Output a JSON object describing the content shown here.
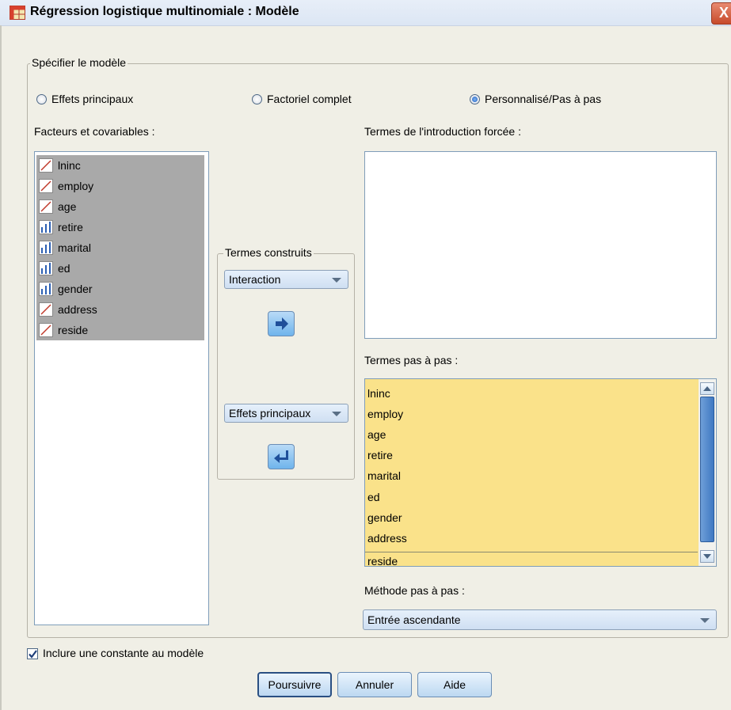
{
  "window": {
    "title": "Régression logistique multinomiale : Modèle",
    "close_glyph": "X"
  },
  "specify_group": {
    "legend": "Spécifier le modèle"
  },
  "model_options": [
    {
      "label": "Effets principaux",
      "selected": false
    },
    {
      "label": "Factoriel complet",
      "selected": false
    },
    {
      "label": "Personnalisé/Pas à pas",
      "selected": true
    }
  ],
  "factors": {
    "label": "Facteurs et covariables :",
    "items": [
      {
        "name": "lninc",
        "icon": "scale-icon"
      },
      {
        "name": "employ",
        "icon": "scale-icon"
      },
      {
        "name": "age",
        "icon": "scale-icon"
      },
      {
        "name": "retire",
        "icon": "nominal-bar-icon"
      },
      {
        "name": "marital",
        "icon": "nominal-bar-icon"
      },
      {
        "name": "ed",
        "icon": "nominal-bar-icon"
      },
      {
        "name": "gender",
        "icon": "nominal-bar-icon"
      },
      {
        "name": "address",
        "icon": "scale-icon"
      },
      {
        "name": "reside",
        "icon": "scale-icon"
      }
    ]
  },
  "built_terms": {
    "legend": "Termes construits",
    "combo_top": "Interaction",
    "combo_bottom": "Effets principaux"
  },
  "forced_terms": {
    "label": "Termes de l'introduction forcée :"
  },
  "stepwise_terms": {
    "label": "Termes pas à pas :",
    "items": [
      "lninc",
      "employ",
      "age",
      "retire",
      "marital",
      "ed",
      "gender",
      "address",
      "reside"
    ]
  },
  "stepwise_method": {
    "label": "Méthode pas à pas :",
    "value": "Entrée ascendante"
  },
  "include_constant": {
    "label": "Inclure une constante au modèle",
    "checked": true
  },
  "buttons": {
    "continue": "Poursuivre",
    "cancel": "Annuler",
    "help": "Aide"
  },
  "colors": {
    "selected_list_bg": "#fae28a",
    "dialog_bg": "#f0efe6",
    "var_selected_bg": "#a9a9a9"
  }
}
